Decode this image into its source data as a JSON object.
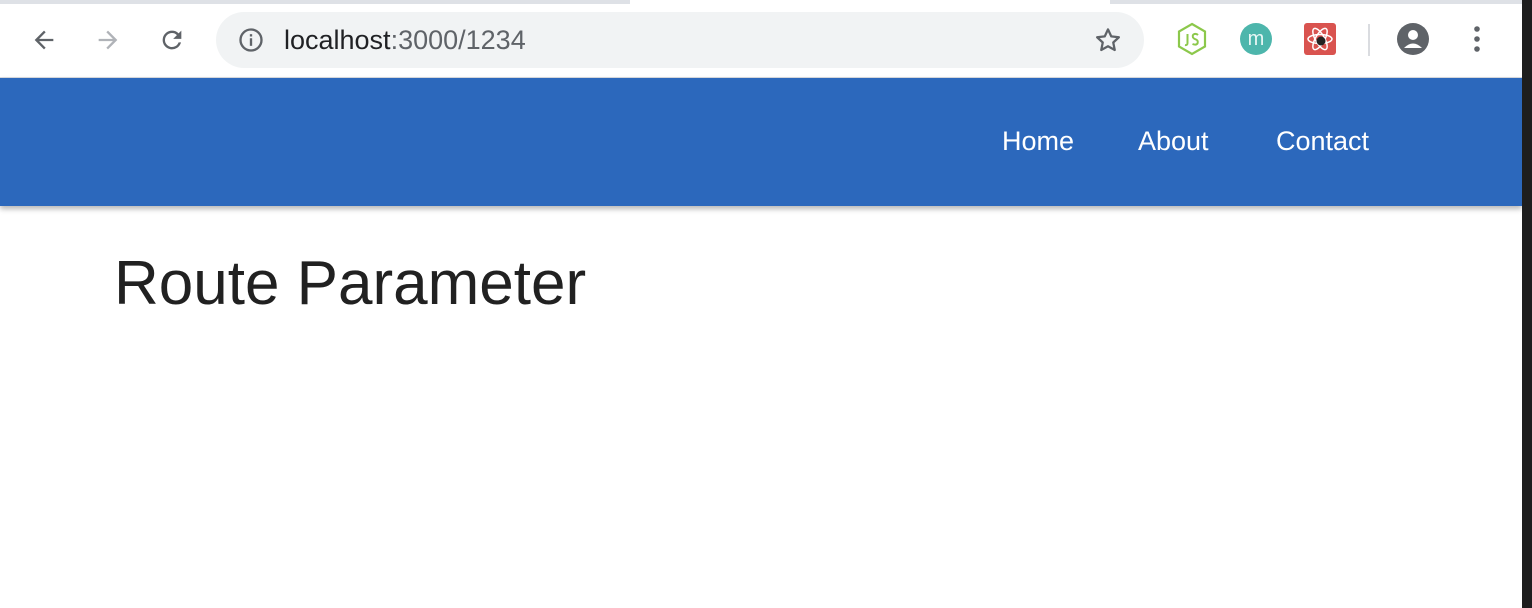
{
  "browser": {
    "omnibox": {
      "host": "localhost",
      "rest": ":3000/1234"
    },
    "icons": {
      "back": "arrow-left-icon",
      "forward": "arrow-right-icon",
      "reload": "reload-icon",
      "info": "info-icon",
      "star": "star-icon",
      "ext1": "nodejs-extension-icon",
      "ext2": "m-extension-icon",
      "ext3": "react-extension-icon",
      "profile": "account-icon",
      "menu": "kebab-menu-icon"
    },
    "ext2_letter": "m",
    "colors": {
      "chrome_bg": "#ffffff",
      "omnibox_bg": "#f1f3f4",
      "node_green": "#8cc84b",
      "m_teal": "#4db6ac",
      "react_red": "#d9534f"
    }
  },
  "app": {
    "nav": {
      "home": "Home",
      "about": "About",
      "contact": "Contact"
    },
    "title": "Route Parameter",
    "colors": {
      "app_bar": "#2c68bc",
      "text": "#212121"
    }
  }
}
